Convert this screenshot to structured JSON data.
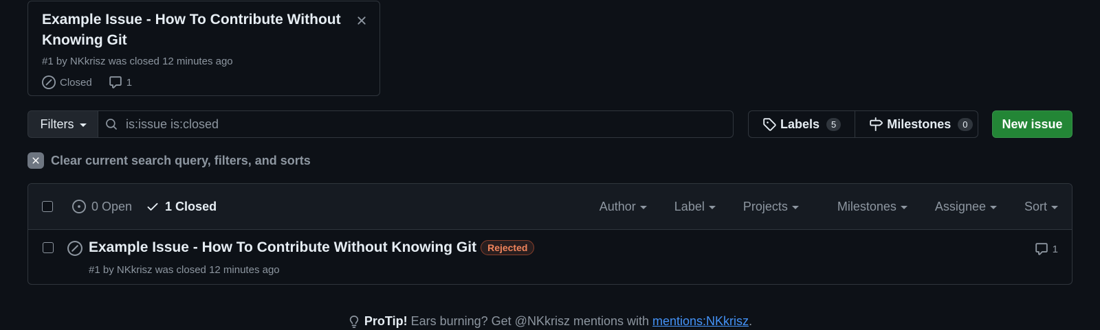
{
  "hovercard": {
    "title": "Example Issue - How To Contribute Without Knowing Git",
    "meta": "#1 by NKkrisz was closed 12 minutes ago",
    "state": "Closed",
    "comments": "1"
  },
  "search": {
    "filters_label": "Filters",
    "query": "is:issue is:closed"
  },
  "toolbar": {
    "labels_label": "Labels",
    "labels_count": "5",
    "milestones_label": "Milestones",
    "milestones_count": "0",
    "new_issue_label": "New issue"
  },
  "clear_query_label": "Clear current search query, filters, and sorts",
  "list_header": {
    "open_label": "0 Open",
    "closed_label": "1 Closed",
    "filters": [
      "Author",
      "Label",
      "Projects",
      "Milestones",
      "Assignee",
      "Sort"
    ]
  },
  "issues": [
    {
      "title": "Example Issue - How To Contribute Without Knowing Git",
      "label": "Rejected",
      "meta": "#1 by NKkrisz was closed 12 minutes ago",
      "comments": "1"
    }
  ],
  "protip": {
    "strong": "ProTip!",
    "text": "Ears burning? Get @NKkrisz mentions with",
    "link": "mentions:NKkrisz",
    "end": "."
  },
  "colors": {
    "background": "#0d1117",
    "accent_green": "#238636",
    "link_blue": "#4493f8",
    "label_rejected": "#f0845c"
  }
}
